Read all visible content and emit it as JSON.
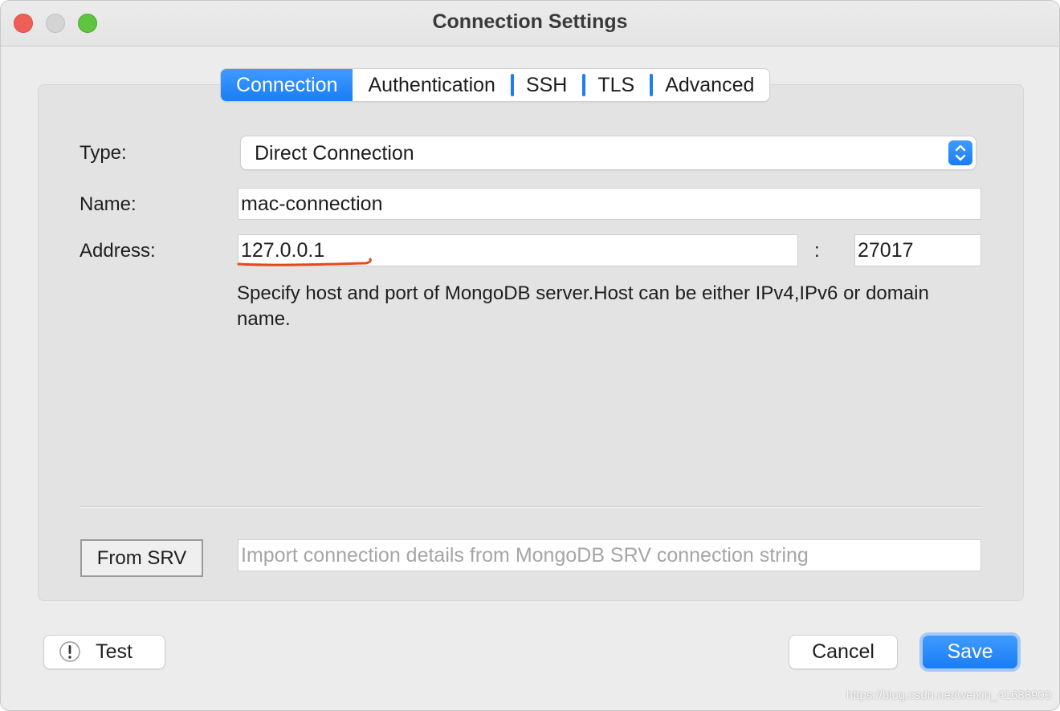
{
  "window": {
    "title": "Connection Settings"
  },
  "tabs": [
    {
      "label": "Connection",
      "active": true
    },
    {
      "label": "Authentication",
      "active": false
    },
    {
      "label": "SSH",
      "active": false
    },
    {
      "label": "TLS",
      "active": false
    },
    {
      "label": "Advanced",
      "active": false
    }
  ],
  "form": {
    "type_label": "Type:",
    "type_value": "Direct Connection",
    "name_label": "Name:",
    "name_value": "mac-connection",
    "address_label": "Address:",
    "host_value": "127.0.0.1",
    "port_separator": ":",
    "port_value": "27017",
    "hint": "Specify host and port of MongoDB server.Host can be either IPv4,IPv6 or domain name."
  },
  "srv": {
    "button_label": "From SRV",
    "placeholder": "Import connection details from MongoDB SRV connection string"
  },
  "footer": {
    "test_label": "Test",
    "cancel_label": "Cancel",
    "save_label": "Save"
  },
  "watermark": "https://blog.csdn.net/weixin_41688900",
  "colors": {
    "accent": "#1a7df5",
    "annotation": "#e8481c"
  }
}
